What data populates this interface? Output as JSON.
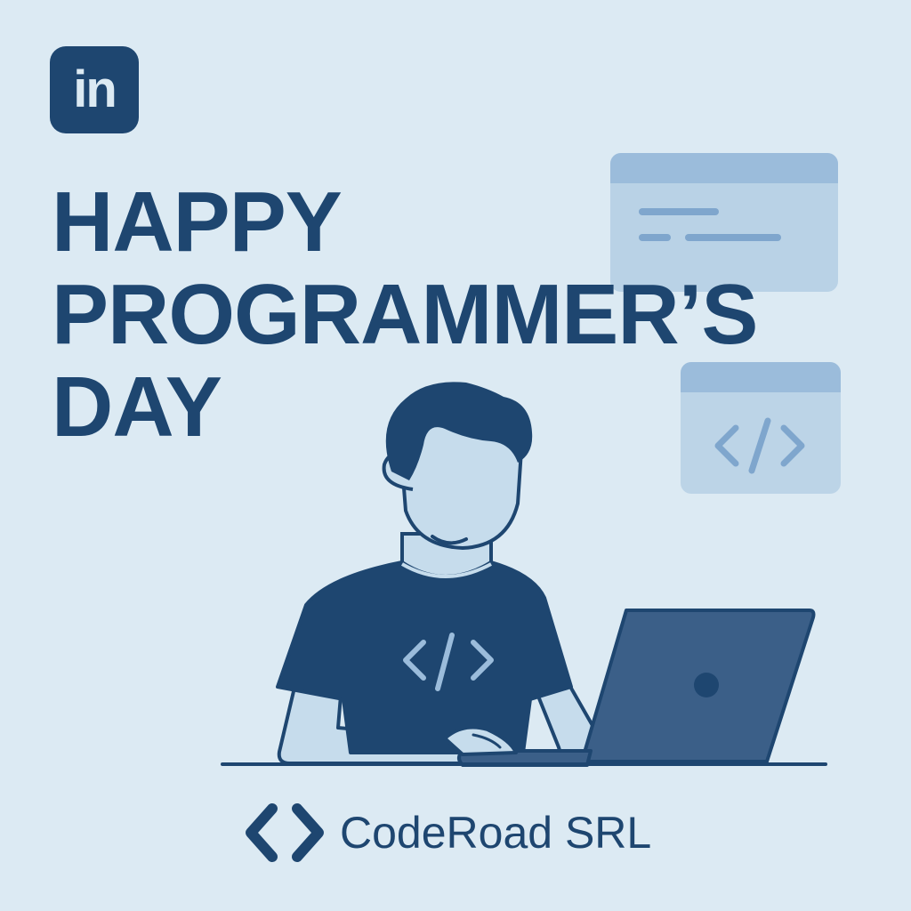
{
  "badge": {
    "text": "in",
    "icon": "linkedin-icon"
  },
  "headline": {
    "line1": "HAPPY",
    "line2": "PROGRAMMER’S",
    "line3": "DAY"
  },
  "brand": {
    "name": "CodeRoad SRL",
    "icon": "code-brackets-icon"
  },
  "colors": {
    "background": "#dceaf3",
    "primary": "#1e4670",
    "skin": "#c6dcec",
    "accent": "#9bbcdb",
    "laptop": "#3b5f88"
  }
}
